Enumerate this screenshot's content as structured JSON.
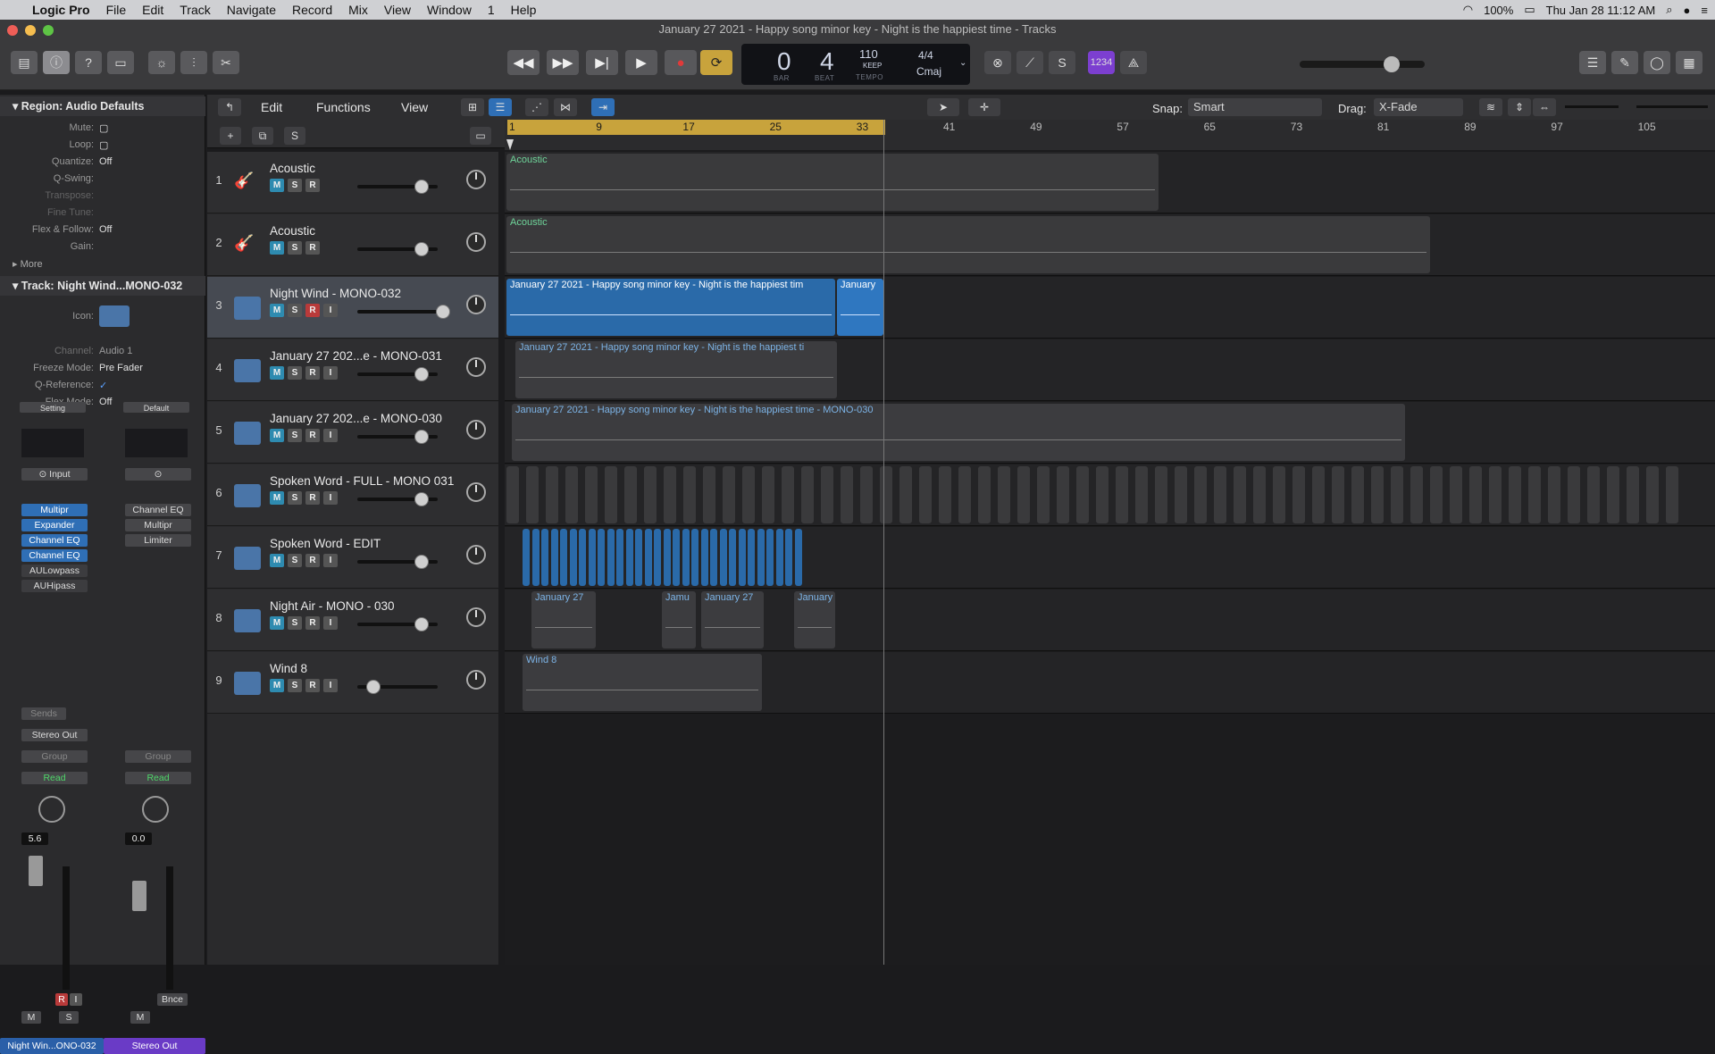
{
  "menubar": {
    "app": "Logic Pro",
    "items": [
      "File",
      "Edit",
      "Track",
      "Navigate",
      "Record",
      "Mix",
      "View",
      "Window",
      "1",
      "Help"
    ],
    "battery": "100%",
    "datetime": "Thu Jan 28  11:12 AM"
  },
  "window": {
    "title": "January 27 2021 - Happy song minor key - Night is the happiest time - Tracks"
  },
  "transport": {
    "bar": "0",
    "beat": "4",
    "bar_label": "BAR",
    "beat_label": "BEAT",
    "tempo": "110",
    "tempo_mode": "KEEP",
    "tempo_label": "TEMPO",
    "signature": "4/4",
    "key": "Cmaj",
    "count_in": "1234"
  },
  "inspector": {
    "region_header": "Region: Audio Defaults",
    "region_rows": [
      {
        "label": "Mute:",
        "value": ""
      },
      {
        "label": "Loop:",
        "value": ""
      },
      {
        "label": "Quantize:",
        "value": "Off"
      },
      {
        "label": "Q-Swing:",
        "value": ""
      },
      {
        "label": "Transpose:",
        "value": ""
      },
      {
        "label": "Fine Tune:",
        "value": ""
      },
      {
        "label": "Flex & Follow:",
        "value": "Off"
      },
      {
        "label": "Gain:",
        "value": ""
      }
    ],
    "more": "More",
    "track_header": "Track:  Night Wind...MONO-032",
    "track_rows": [
      {
        "label": "Icon:",
        "value": ""
      },
      {
        "label": "Channel:",
        "value": "Audio 1"
      },
      {
        "label": "Freeze Mode:",
        "value": "Pre Fader"
      },
      {
        "label": "Q-Reference:",
        "value": "✓"
      },
      {
        "label": "Flex Mode:",
        "value": "Off"
      }
    ],
    "strip1": {
      "setting": "Setting",
      "input": "Input",
      "plugins": [
        "Multipr",
        "Expander",
        "Channel EQ",
        "Channel EQ",
        "AULowpass",
        "AUHipass"
      ],
      "sends": "Sends",
      "output": "Stereo Out",
      "group": "Group",
      "automation": "Read",
      "volume": "5.6",
      "name": "Night Win...ONO-032",
      "buttons": [
        "M",
        "S"
      ]
    },
    "strip2": {
      "setting": "Default",
      "plugins": [
        "Channel EQ",
        "Multipr",
        "Limiter"
      ],
      "group": "Group",
      "automation": "Read",
      "volume": "0.0",
      "bounce": "Bnce",
      "name": "Stereo Out",
      "buttons": [
        "M"
      ]
    },
    "fader_scale": [
      "0",
      "3",
      "6",
      "9",
      "12",
      "15",
      "18",
      "21",
      "24",
      "30",
      "35",
      "40",
      "45",
      "50",
      "60"
    ]
  },
  "tracks_toolbar": {
    "edit": "Edit",
    "functions": "Functions",
    "view": "View",
    "snap_label": "Snap:",
    "snap_value": "Smart",
    "drag_label": "Drag:",
    "drag_value": "X-Fade",
    "s_button": "S"
  },
  "ruler": {
    "marks": [
      "1",
      "9",
      "17",
      "25",
      "33",
      "41",
      "49",
      "57",
      "65",
      "73",
      "81",
      "89",
      "97",
      "105"
    ]
  },
  "tracks": [
    {
      "num": "1",
      "name": "Acoustic",
      "buttons": [
        "M",
        "S",
        "R"
      ],
      "selected": false,
      "icon": "guitar-icon"
    },
    {
      "num": "2",
      "name": "Acoustic",
      "buttons": [
        "M",
        "S",
        "R"
      ],
      "selected": false,
      "icon": "guitar-icon"
    },
    {
      "num": "3",
      "name": "Night Wind - MONO-032",
      "buttons": [
        "M",
        "S",
        "R",
        "I"
      ],
      "selected": true,
      "icon": "waveform-icon"
    },
    {
      "num": "4",
      "name": "January 27 202...e - MONO-031",
      "buttons": [
        "M",
        "S",
        "R",
        "I"
      ],
      "selected": false,
      "icon": "waveform-icon"
    },
    {
      "num": "5",
      "name": "January 27 202...e - MONO-030",
      "buttons": [
        "M",
        "S",
        "R",
        "I"
      ],
      "selected": false,
      "icon": "waveform-icon"
    },
    {
      "num": "6",
      "name": "Spoken Word - FULL - MONO 031",
      "buttons": [
        "M",
        "S",
        "R",
        "I"
      ],
      "selected": false,
      "icon": "waveform-icon"
    },
    {
      "num": "7",
      "name": "Spoken Word - EDIT",
      "buttons": [
        "M",
        "S",
        "R",
        "I"
      ],
      "selected": false,
      "icon": "waveform-icon"
    },
    {
      "num": "8",
      "name": "Night Air - MONO - 030",
      "buttons": [
        "M",
        "S",
        "R",
        "I"
      ],
      "selected": false,
      "icon": "waveform-icon"
    },
    {
      "num": "9",
      "name": "Wind 8",
      "buttons": [
        "M",
        "S",
        "R",
        "I"
      ],
      "selected": false,
      "icon": "waveform-icon"
    }
  ],
  "regions": {
    "r1": "Acoustic",
    "r2": "Acoustic",
    "r3a": "January 27 2021 - Happy song minor key - Night is the happiest tim",
    "r3b": "January",
    "r4": "January 27 2021 - Happy song minor key - Night is the happiest ti",
    "r5": "January 27 2021 - Happy song minor key - Night is the happiest time - MONO-030",
    "r8a": "January 27",
    "r8b": "Jamu",
    "r8c": "January 27",
    "r8d": "January",
    "r9": "Wind 8"
  }
}
